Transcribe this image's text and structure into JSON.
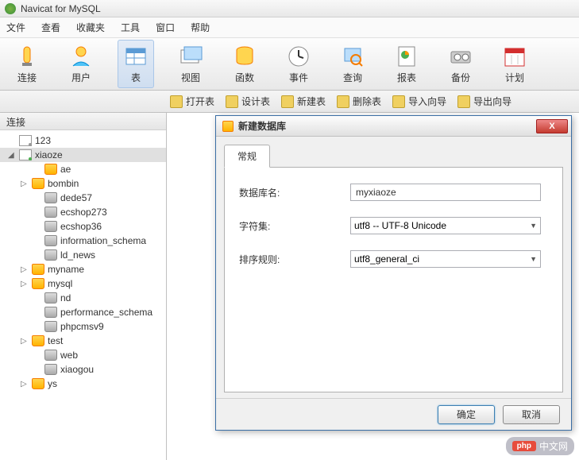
{
  "window": {
    "title": "Navicat for MySQL"
  },
  "menu": {
    "items": [
      "文件",
      "查看",
      "收藏夹",
      "工具",
      "窗口",
      "帮助"
    ]
  },
  "toolbar": {
    "items": [
      {
        "label": "连接",
        "icon": "plug"
      },
      {
        "label": "用户",
        "icon": "user"
      },
      {
        "label": "表",
        "icon": "table",
        "active": true
      },
      {
        "label": "视图",
        "icon": "view"
      },
      {
        "label": "函数",
        "icon": "function"
      },
      {
        "label": "事件",
        "icon": "event"
      },
      {
        "label": "查询",
        "icon": "query"
      },
      {
        "label": "报表",
        "icon": "report"
      },
      {
        "label": "备份",
        "icon": "backup"
      },
      {
        "label": "计划",
        "icon": "schedule"
      }
    ]
  },
  "subtoolbar": {
    "items": [
      "打开表",
      "设计表",
      "新建表",
      "删除表",
      "导入向导",
      "导出向导"
    ]
  },
  "sidebar": {
    "header": "连接",
    "tree": [
      {
        "label": "123",
        "type": "server-gray"
      },
      {
        "label": "xiaoze",
        "type": "server",
        "expanded": true,
        "selected": true
      },
      {
        "label": "ae",
        "type": "db",
        "level": 2
      },
      {
        "label": "bombin",
        "type": "db",
        "level": 2,
        "arrow": true
      },
      {
        "label": "dede57",
        "type": "db-gray",
        "level": 2
      },
      {
        "label": "ecshop273",
        "type": "db-gray",
        "level": 2
      },
      {
        "label": "ecshop36",
        "type": "db-gray",
        "level": 2
      },
      {
        "label": "information_schema",
        "type": "db-gray",
        "level": 2
      },
      {
        "label": "ld_news",
        "type": "db-gray",
        "level": 2
      },
      {
        "label": "myname",
        "type": "db",
        "level": 2,
        "arrow": true
      },
      {
        "label": "mysql",
        "type": "db",
        "level": 2,
        "arrow": true
      },
      {
        "label": "nd",
        "type": "db-gray",
        "level": 2
      },
      {
        "label": "performance_schema",
        "type": "db-gray",
        "level": 2
      },
      {
        "label": "phpcmsv9",
        "type": "db-gray",
        "level": 2
      },
      {
        "label": "test",
        "type": "db",
        "level": 2,
        "arrow": true
      },
      {
        "label": "web",
        "type": "db-gray",
        "level": 2
      },
      {
        "label": "xiaogou",
        "type": "db-gray",
        "level": 2
      },
      {
        "label": "ys",
        "type": "db",
        "level": 2,
        "arrow": true
      }
    ]
  },
  "dialog": {
    "title": "新建数据库",
    "tab": "常规",
    "fields": {
      "dbname_label": "数据库名:",
      "dbname_value": "myxiaoze",
      "charset_label": "字符集:",
      "charset_value": "utf8 -- UTF-8 Unicode",
      "collation_label": "排序规则:",
      "collation_value": "utf8_general_ci"
    },
    "buttons": {
      "ok": "确定",
      "cancel": "取消"
    },
    "close": "X"
  },
  "watermark": {
    "badge": "php",
    "text": "中文网"
  }
}
